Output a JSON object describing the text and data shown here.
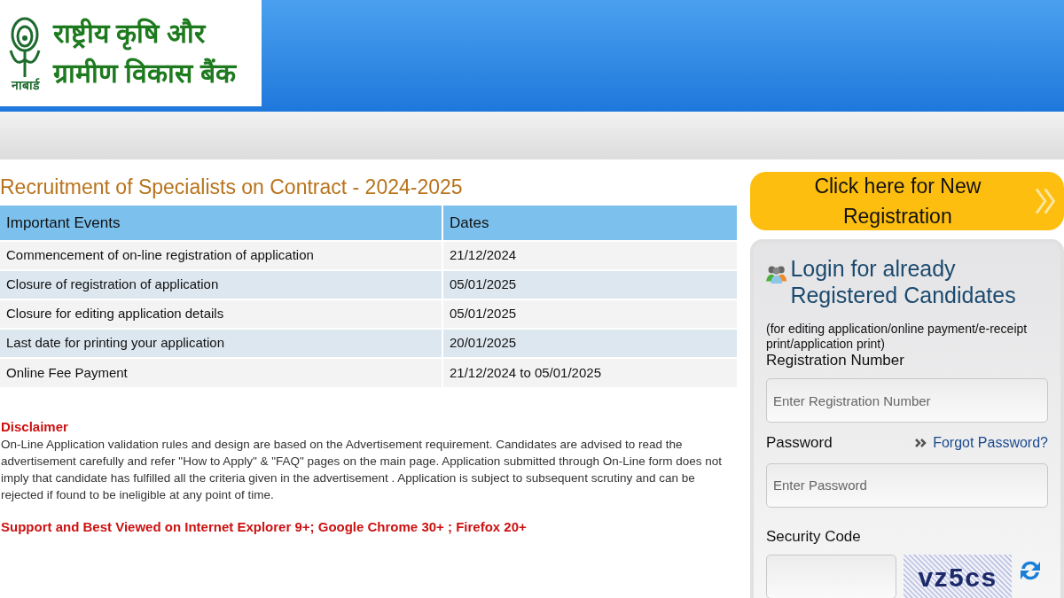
{
  "header": {
    "logo_caption": "नाबार्ड",
    "logo_lines": [
      "राष्ट्रीय कृषि और",
      "ग्रामीण विकास बैंक"
    ]
  },
  "title": "Recruitment of Specialists on Contract - 2024-2025",
  "table": {
    "columns": [
      "Important Events",
      "Dates"
    ],
    "rows": [
      [
        "Commencement of on-line registration of application",
        "21/12/2024"
      ],
      [
        "Closure of registration of application",
        "05/01/2025"
      ],
      [
        "Closure for editing application details",
        "05/01/2025"
      ],
      [
        "Last date for printing your application",
        "20/01/2025"
      ],
      [
        "Online Fee Payment",
        "21/12/2024 to 05/01/2025"
      ]
    ]
  },
  "disclaimer": {
    "heading": "Disclaimer",
    "text": "On-Line Application validation rules and design are based on the Advertisement requirement. Candidates are advised to read the advertisement carefully and refer \"How to Apply\" & \"FAQ\" pages on the main page. Application submitted through On-Line form does not imply that candidate has fulfilled all the criteria given in the advertisement . Application is subject to subsequent scrutiny and can be rejected if found to be ineligible at any point of time."
  },
  "support_note": "Support and Best Viewed on Internet Explorer 9+; Google Chrome 30+ ; Firefox 20+",
  "new_registration_button": "Click here for New Registration",
  "login": {
    "title": "Login for already Registered Candidates",
    "subtitle": "(for editing application/online payment/e-receipt print/application print)",
    "registration_label": "Registration Number",
    "registration_placeholder": "Enter Registration Number",
    "password_label": "Password",
    "forgot_link": "Forgot Password?",
    "password_placeholder": "Enter Password",
    "security_label": "Security Code",
    "captcha_text": "vz5cs"
  }
}
